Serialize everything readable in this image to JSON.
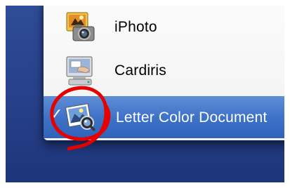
{
  "menu": {
    "items": [
      {
        "label": "iPhoto",
        "icon": "iphoto-camera-icon",
        "selected": false
      },
      {
        "label": "Cardiris",
        "icon": "cardiris-scanner-icon",
        "selected": false
      },
      {
        "label": "Letter Color Document",
        "icon": "preview-image-icon",
        "selected": true,
        "checked": true
      }
    ]
  },
  "colors": {
    "desktop": "#26408a",
    "selection": "#3f73c8",
    "annotation_circle": "#e60000"
  }
}
